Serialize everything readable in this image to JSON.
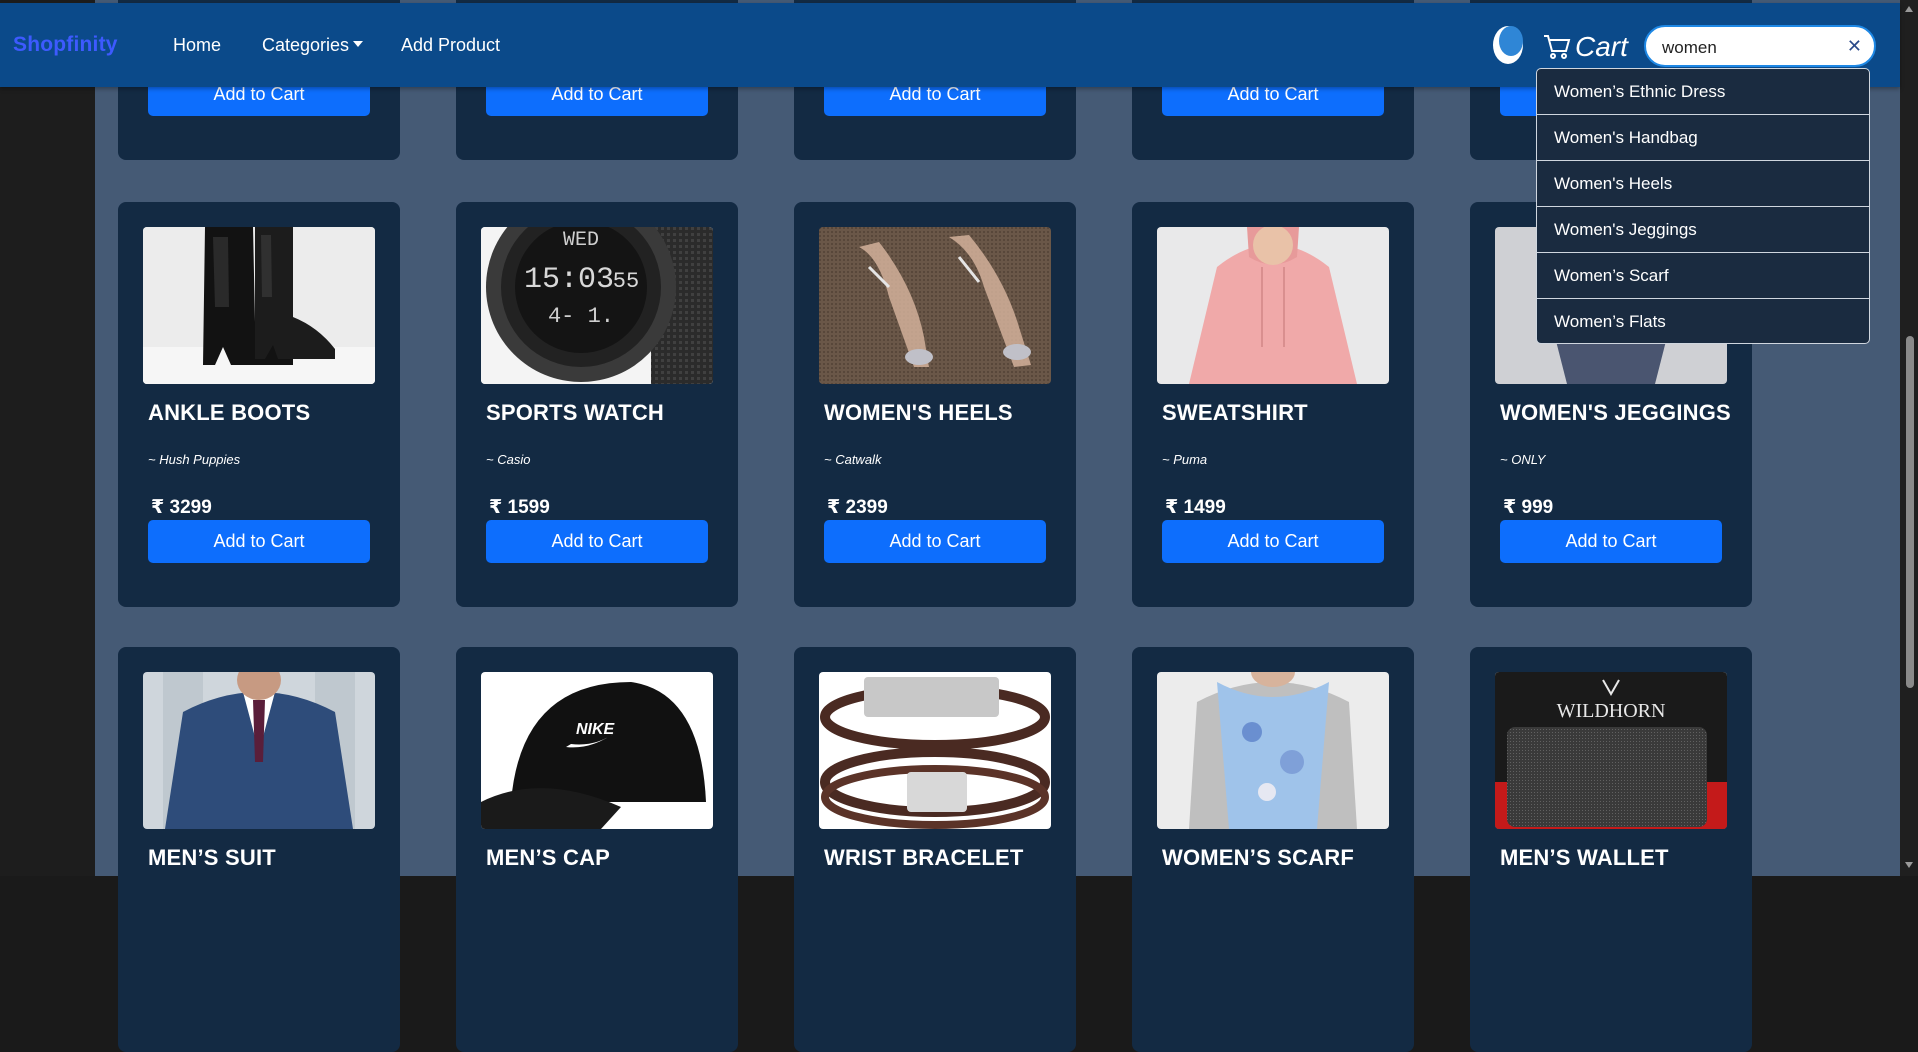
{
  "navbar": {
    "brand": "Shopfinity",
    "links": [
      "Home",
      "Categories",
      "Add Product"
    ],
    "cart_label": "Cart",
    "search_value": "women",
    "clear_symbol": "✕"
  },
  "dropdown": {
    "items": [
      "Women’s Ethnic Dress",
      "Women's Handbag",
      "Women's Heels",
      "Women's Jeggings",
      "Women’s Scarf",
      "Women’s Flats"
    ]
  },
  "add_to_cart_label": "Add to Cart",
  "currency_symbol": "₹",
  "products_row2": [
    {
      "title": "ANKLE BOOTS",
      "brand": "~ Hush Puppies",
      "price": "3299"
    },
    {
      "title": "SPORTS WATCH",
      "brand": "~ Casio",
      "price": "1599"
    },
    {
      "title": "WOMEN'S HEELS",
      "brand": "~ Catwalk",
      "price": "2399"
    },
    {
      "title": "SWEATSHIRT",
      "brand": "~ Puma",
      "price": "1499"
    },
    {
      "title": "WOMEN'S JEGGINGS",
      "brand": "~ ONLY",
      "price": "999"
    }
  ],
  "products_row3": [
    {
      "title": "MEN’S SUIT"
    },
    {
      "title": "MEN’S CAP"
    },
    {
      "title": "WRIST BRACELET"
    },
    {
      "title": "WOMEN’S SCARF"
    },
    {
      "title": "MEN’S WALLET"
    }
  ],
  "image_texts": {
    "watch_day": "WED",
    "watch_time": "15:03",
    "watch_seconds": "55",
    "cap_logo": "NIKE",
    "wallet_brand": "WILDHORN"
  },
  "colors": {
    "navbar": "#0b4a8a",
    "page": "#455a75",
    "card": "#132a43",
    "button": "#0d6efd",
    "brand": "#3d5afe"
  }
}
